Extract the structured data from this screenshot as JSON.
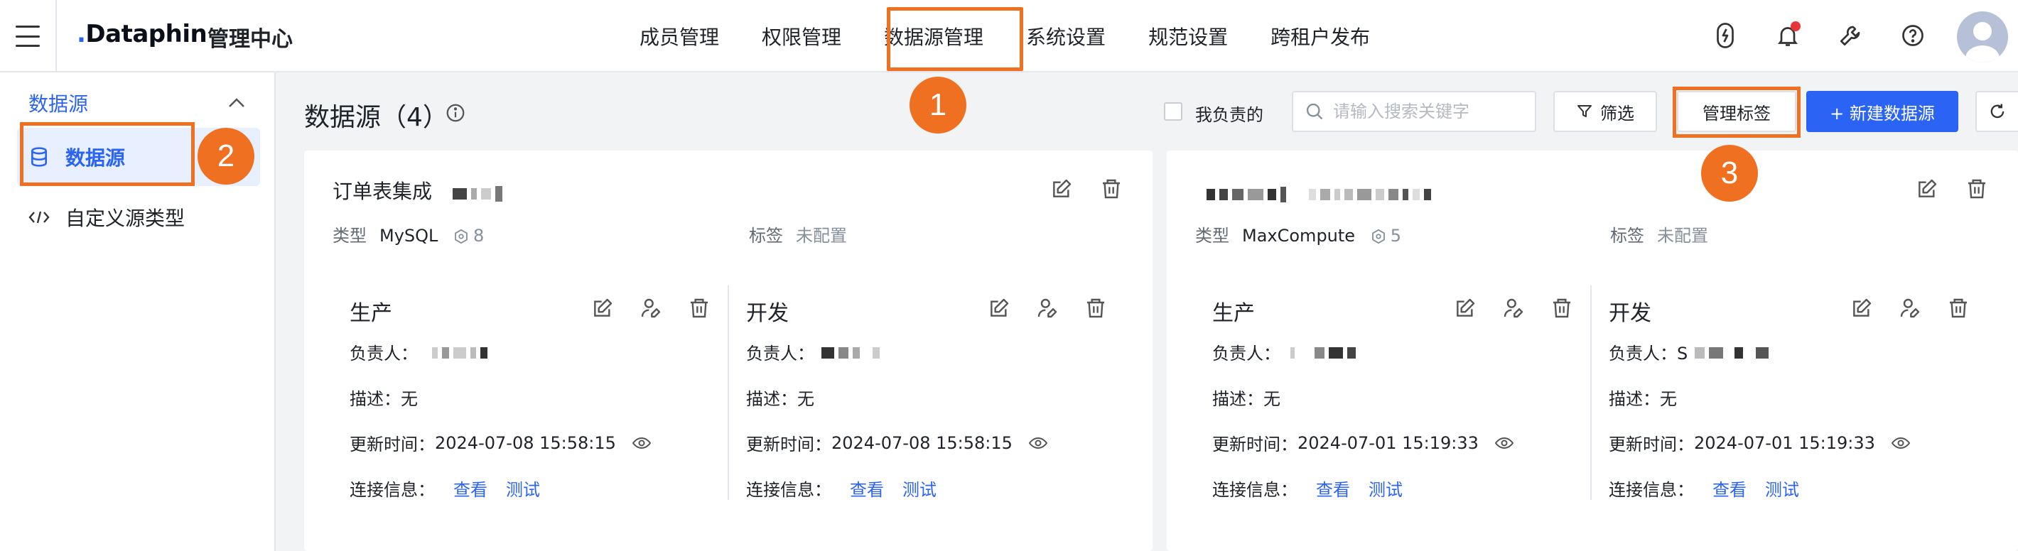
{
  "topbar": {
    "logo": "Dataphin",
    "logo_sub": "管理中心",
    "nav": [
      "成员管理",
      "权限管理",
      "数据源管理",
      "系统设置",
      "规范设置",
      "跨租户发布"
    ],
    "active_nav": "数据源管理",
    "icons": [
      "lightning-icon",
      "bell-icon",
      "wrench-icon",
      "help-icon"
    ],
    "notification_dot_color": "#e8353a"
  },
  "sidebar": {
    "group_label": "数据源",
    "items": [
      {
        "label": "数据源",
        "icon": "database-icon",
        "active": true
      },
      {
        "label": "自定义源类型",
        "icon": "code-icon",
        "active": false
      }
    ]
  },
  "badges": [
    "1",
    "2",
    "3"
  ],
  "header": {
    "title": "数据源（4）",
    "mine_label": "我负责的",
    "search_placeholder": "请输入搜索关键字",
    "filter_label": "筛选",
    "manage_tags_label": "管理标签",
    "new_label": "+ 新建数据源"
  },
  "cards": [
    {
      "title": "订单表集成",
      "type_label": "类型",
      "type_value": "MySQL",
      "type_count": "8",
      "tag_label": "标签",
      "tag_value": "未配置",
      "envs": [
        {
          "name": "生产",
          "owner_label": "负责人：",
          "desc_label": "描述：",
          "desc_value": "无",
          "time_label": "更新时间：",
          "time_value": "2024-07-08 15:58:15",
          "conn_label": "连接信息：",
          "view_label": "查看",
          "test_label": "测试"
        },
        {
          "name": "开发",
          "owner_label": "负责人：",
          "desc_label": "描述：",
          "desc_value": "无",
          "time_label": "更新时间：",
          "time_value": "2024-07-08 15:58:15",
          "conn_label": "连接信息：",
          "view_label": "查看",
          "test_label": "测试"
        }
      ]
    },
    {
      "title": "",
      "type_label": "类型",
      "type_value": "MaxCompute",
      "type_count": "5",
      "tag_label": "标签",
      "tag_value": "未配置",
      "envs": [
        {
          "name": "生产",
          "owner_label": "负责人：",
          "desc_label": "描述：",
          "desc_value": "无",
          "time_label": "更新时间：",
          "time_value": "2024-07-01 15:19:33",
          "conn_label": "连接信息：",
          "view_label": "查看",
          "test_label": "测试"
        },
        {
          "name": "开发",
          "owner_label": "负责人：S",
          "desc_label": "描述：",
          "desc_value": "无",
          "time_label": "更新时间：",
          "time_value": "2024-07-01 15:19:33",
          "conn_label": "连接信息：",
          "view_label": "查看",
          "test_label": "测试"
        }
      ]
    }
  ],
  "colors": {
    "accent": "#2b64f4",
    "highlight": "#f07022",
    "active_bg": "#e8efff"
  }
}
